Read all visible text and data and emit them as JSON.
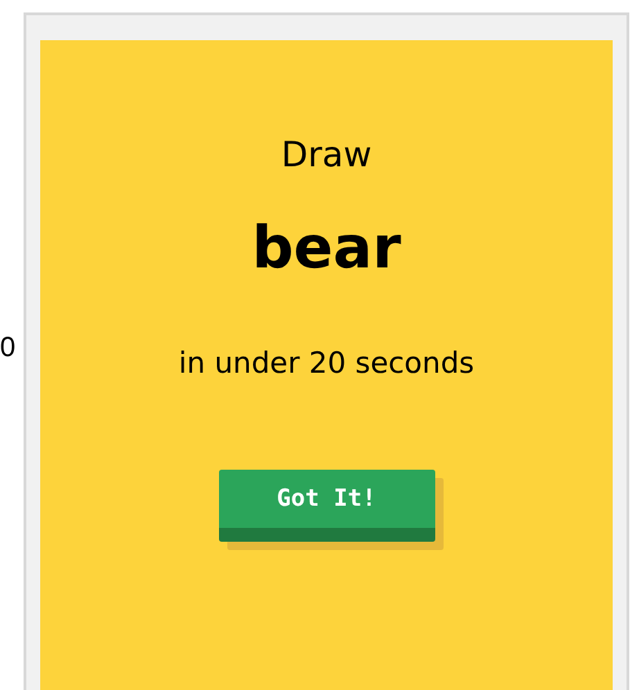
{
  "side_text": "0",
  "prompt": {
    "lead": "Draw",
    "word": "bear",
    "time_limit": "in under 20 seconds"
  },
  "button": {
    "label": "Got It!"
  }
}
